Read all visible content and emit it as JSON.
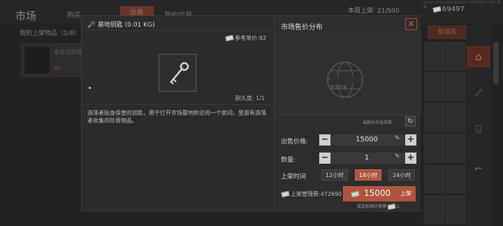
{
  "background": {
    "market_title": "市场",
    "tabs": [
      "购买",
      "出售",
      "我的交易"
    ],
    "listed_count": "本周上架: 21/500",
    "coins": "69497",
    "version": "1.0.88.30(5) / 0413(10291) / 66785530 / 166 | 西服",
    "my_items": "我的上架物品（1/8）",
    "item_card_name": "金丝边眼镜",
    "item_card_price": "42",
    "right_tab": "管理库"
  },
  "item": {
    "name": "墓地钥匙 (0.01 KG)",
    "ref_price_label": "参考单价:",
    "ref_price": "92",
    "durability_label": "耐久度:",
    "durability": "1/1",
    "description": "游荡者贴身保管的钥匙，用于打开农场墓地附近的一个房间，里面有游荡者收集的珍贵物品。"
  },
  "distribution": {
    "title": "市场售价分布",
    "close": "✕",
    "no_data": "暂无列表",
    "lowest_price_hint": "当前价位挂单数",
    "refresh_icon": "↻"
  },
  "form": {
    "price_label": "出售价格:",
    "price_value": "15000",
    "quantity_label": "数量:",
    "quantity_value": "1",
    "duration_label": "上架时间",
    "durations": [
      "12小时",
      "18小时",
      "24小时"
    ],
    "selected_duration": "18小时",
    "fee_label": "上架管理费:",
    "fee_value": "472690",
    "list_button_price": "15000",
    "list_button_label": "上架",
    "expected_label": "成交后预计获得",
    "expected_value": "1",
    "minus": "−",
    "plus": "+"
  },
  "colors": {
    "accent": "#b0553d",
    "close": "#d85040"
  }
}
